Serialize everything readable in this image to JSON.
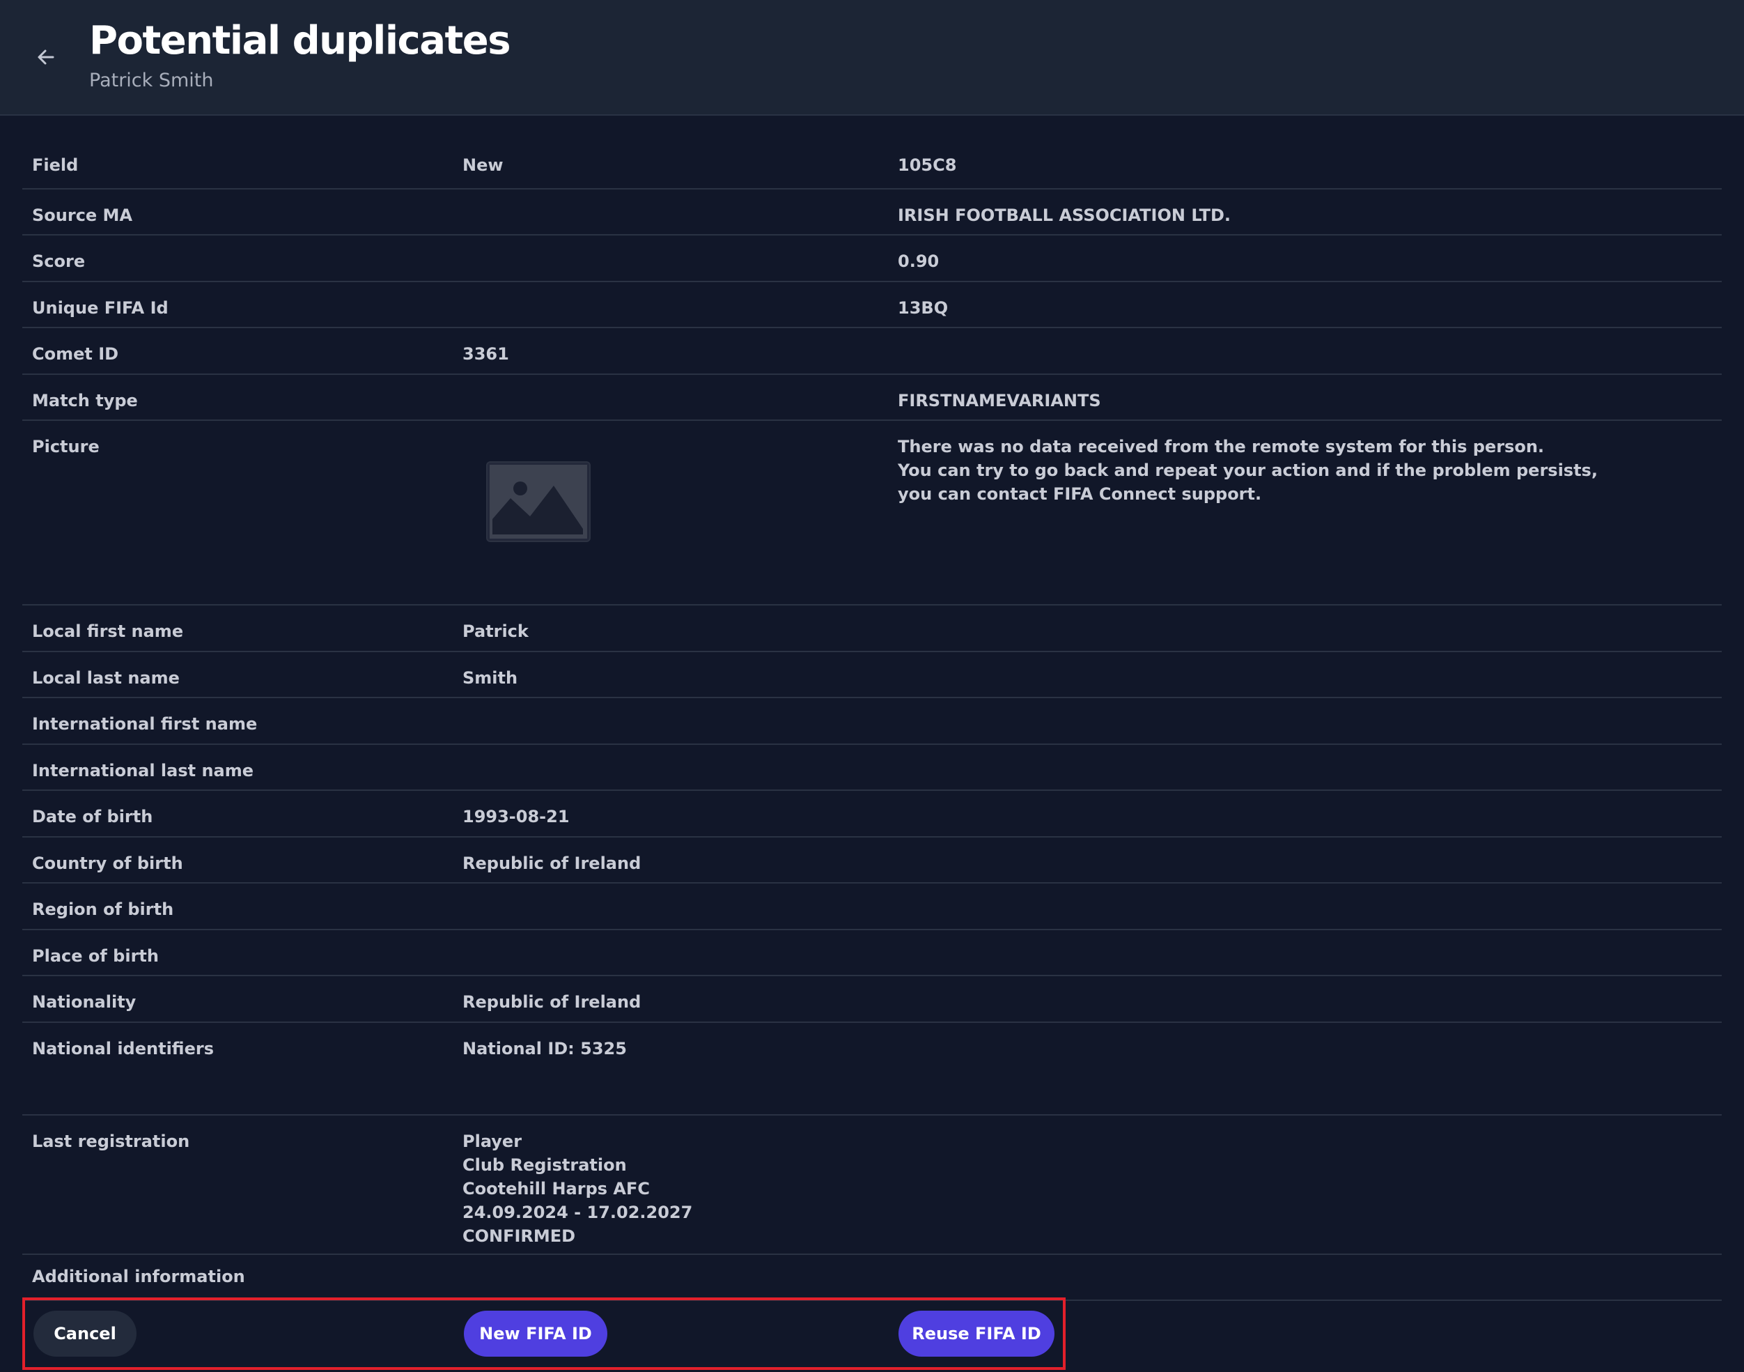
{
  "header": {
    "title": "Potential duplicates",
    "subtitle": "Patrick Smith",
    "back_icon": "arrow-left-icon"
  },
  "table": {
    "columns": [
      "Field",
      "New",
      "105C8"
    ],
    "rows": [
      {
        "field": "Source MA",
        "new": "",
        "match": "IRISH FOOTBALL ASSOCIATION LTD."
      },
      {
        "field": "Score",
        "new": "",
        "match": "0.90"
      },
      {
        "field": "Unique FIFA Id",
        "new": "",
        "match": "13BQ"
      },
      {
        "field": "Comet ID",
        "new": "3361",
        "match": ""
      },
      {
        "field": "Match type",
        "new": "",
        "match": "FIRSTNAMEVARIANTS"
      },
      {
        "field": "Picture",
        "new_icon": "image-placeholder-icon",
        "match_lines": [
          "There was no data received from the remote system for this person.",
          "You can try to go back and repeat your action and if the problem persists,",
          "you can contact FIFA Connect support."
        ]
      },
      {
        "field": "Local first name",
        "new": "Patrick",
        "match": ""
      },
      {
        "field": "Local last name",
        "new": "Smith",
        "match": ""
      },
      {
        "field": "International first name",
        "new": "",
        "match": ""
      },
      {
        "field": "International last name",
        "new": "",
        "match": ""
      },
      {
        "field": "Date of birth",
        "new": "1993-08-21",
        "match": ""
      },
      {
        "field": "Country of birth",
        "new": "Republic of Ireland",
        "match": ""
      },
      {
        "field": "Region of birth",
        "new": "",
        "match": ""
      },
      {
        "field": "Place of birth",
        "new": "",
        "match": ""
      },
      {
        "field": "Nationality",
        "new": "Republic of Ireland",
        "match": ""
      },
      {
        "field": "National identifiers",
        "new": "National ID: 5325",
        "match": ""
      },
      {
        "field": "Last registration",
        "new_lines": [
          "Player",
          "Club Registration",
          "Cootehill Harps AFC",
          "24.09.2024 - 17.02.2027",
          "CONFIRMED"
        ],
        "match": ""
      },
      {
        "field": "Additional information",
        "new": "",
        "match": ""
      }
    ]
  },
  "actions": {
    "cancel_label": "Cancel",
    "new_fifa_id_label": "New FIFA ID",
    "reuse_fifa_id_label": "Reuse FIFA ID"
  },
  "colors": {
    "background": "#111729",
    "header_background": "#1c2535",
    "primary_button": "#4f3fe0",
    "highlight_border": "#e3202b"
  }
}
